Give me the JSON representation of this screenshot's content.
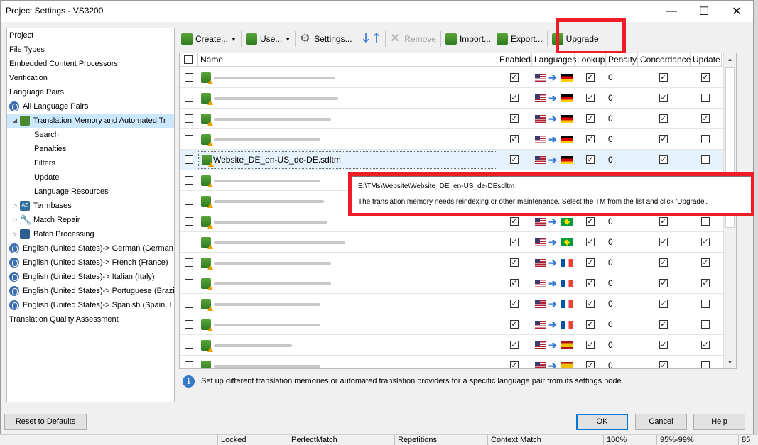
{
  "window": {
    "title": "Project Settings - VS3200",
    "minimize": "—",
    "maximize": "☐",
    "close": "✕"
  },
  "tree": [
    {
      "label": "Project",
      "indent": 0,
      "twisty": "",
      "icon": ""
    },
    {
      "label": "File Types",
      "indent": 0,
      "twisty": "",
      "icon": ""
    },
    {
      "label": "Embedded Content Processors",
      "indent": 0,
      "twisty": "",
      "icon": ""
    },
    {
      "label": "Verification",
      "indent": 0,
      "twisty": "",
      "icon": ""
    },
    {
      "label": "Language Pairs",
      "indent": 0,
      "twisty": "",
      "icon": ""
    },
    {
      "label": "All Language Pairs",
      "indent": 0,
      "twisty": "",
      "icon": "globe-icon"
    },
    {
      "label": "Translation Memory and Automated Tr",
      "indent": 1,
      "twisty": "◢",
      "icon": "tm-icon",
      "selected": true
    },
    {
      "label": "Search",
      "indent": 2,
      "twisty": "",
      "icon": ""
    },
    {
      "label": "Penalties",
      "indent": 2,
      "twisty": "",
      "icon": ""
    },
    {
      "label": "Filters",
      "indent": 2,
      "twisty": "",
      "icon": ""
    },
    {
      "label": "Update",
      "indent": 2,
      "twisty": "",
      "icon": ""
    },
    {
      "label": "Language Resources",
      "indent": 2,
      "twisty": "",
      "icon": ""
    },
    {
      "label": "Termbases",
      "indent": 1,
      "twisty": "▷",
      "icon": "termbase-icon"
    },
    {
      "label": "Match Repair",
      "indent": 1,
      "twisty": "▷",
      "icon": "wrench-icon"
    },
    {
      "label": "Batch Processing",
      "indent": 1,
      "twisty": "▷",
      "icon": "batch-icon"
    },
    {
      "label": "English (United States)-> German (German",
      "indent": 0,
      "twisty": "",
      "icon": "globe-icon"
    },
    {
      "label": "English (United States)-> French (France)",
      "indent": 0,
      "twisty": "",
      "icon": "globe-icon"
    },
    {
      "label": "English (United States)-> Italian (Italy)",
      "indent": 0,
      "twisty": "",
      "icon": "globe-icon"
    },
    {
      "label": "English (United States)-> Portuguese (Brazi",
      "indent": 0,
      "twisty": "",
      "icon": "globe-icon"
    },
    {
      "label": "English (United States)-> Spanish (Spain, I",
      "indent": 0,
      "twisty": "",
      "icon": "globe-icon"
    },
    {
      "label": "Translation Quality Assessment",
      "indent": 0,
      "twisty": "",
      "icon": ""
    }
  ],
  "toolbar": {
    "create": "Create...",
    "use": "Use...",
    "settings": "Settings...",
    "remove": "Remove",
    "import": "Import...",
    "export": "Export...",
    "upgrade": "Upgrade",
    "move_down": "🡓",
    "move_up": "🡑"
  },
  "grid": {
    "headers": [
      "Name",
      "Enabled",
      "Languages",
      "Lookup",
      "Penalty",
      "Concordance",
      "Update"
    ],
    "rows": [
      {
        "name": "",
        "target": "de",
        "enabled": true,
        "lookup": true,
        "penalty": "0",
        "concordance": true,
        "update": true
      },
      {
        "name": "",
        "target": "de",
        "enabled": true,
        "lookup": true,
        "penalty": "0",
        "concordance": true,
        "update": false
      },
      {
        "name": "",
        "target": "de",
        "enabled": true,
        "lookup": true,
        "penalty": "0",
        "concordance": true,
        "update": true
      },
      {
        "name": "",
        "target": "de",
        "enabled": true,
        "lookup": true,
        "penalty": "0",
        "concordance": true,
        "update": false
      },
      {
        "name": "Website_DE_en-US_de-DE.sdltm",
        "target": "de",
        "enabled": true,
        "lookup": true,
        "penalty": "0",
        "concordance": true,
        "update": false,
        "selected": true
      },
      {
        "name": "",
        "target": "de",
        "enabled": true,
        "lookup": true,
        "penalty": "0",
        "concordance": true,
        "update": true,
        "hidden": true
      },
      {
        "name": "",
        "target": "br",
        "enabled": true,
        "lookup": true,
        "penalty": "0",
        "concordance": true,
        "update": true,
        "hidden": true
      },
      {
        "name": "",
        "target": "br",
        "enabled": true,
        "lookup": true,
        "penalty": "0",
        "concordance": true,
        "update": false
      },
      {
        "name": "",
        "target": "br",
        "enabled": true,
        "lookup": true,
        "penalty": "0",
        "concordance": true,
        "update": true
      },
      {
        "name": "",
        "target": "fr",
        "enabled": true,
        "lookup": true,
        "penalty": "0",
        "concordance": true,
        "update": true
      },
      {
        "name": "",
        "target": "fr",
        "enabled": true,
        "lookup": true,
        "penalty": "0",
        "concordance": true,
        "update": true
      },
      {
        "name": "",
        "target": "fr",
        "enabled": true,
        "lookup": true,
        "penalty": "0",
        "concordance": true,
        "update": false
      },
      {
        "name": "",
        "target": "fr",
        "enabled": true,
        "lookup": true,
        "penalty": "0",
        "concordance": true,
        "update": false
      },
      {
        "name": "",
        "target": "es",
        "enabled": true,
        "lookup": true,
        "penalty": "0",
        "concordance": true,
        "update": true
      },
      {
        "name": "",
        "target": "es",
        "enabled": true,
        "lookup": true,
        "penalty": "0",
        "concordance": true,
        "update": false
      }
    ]
  },
  "tooltip": {
    "path": "E:\\TMs\\Website\\Website_DE_en-US_de-DEsdltm",
    "message": "The translation memory needs reindexing or other maintenance. Select the TM from the list and click 'Upgrade'."
  },
  "info_text": "Set up different translation memories or automated translation providers for a specific language pair from its settings node.",
  "buttons": {
    "reset": "Reset to Defaults",
    "ok": "OK",
    "cancel": "Cancel",
    "help": "Help"
  },
  "statusbar": [
    "Locked",
    "PerfectMatch",
    "Repetitions",
    "Context Match",
    "100%",
    "95%-99%",
    "85"
  ],
  "colors": {
    "highlight": "#ee1c24",
    "selection": "#cce8ff",
    "accent": "#0078d7"
  }
}
